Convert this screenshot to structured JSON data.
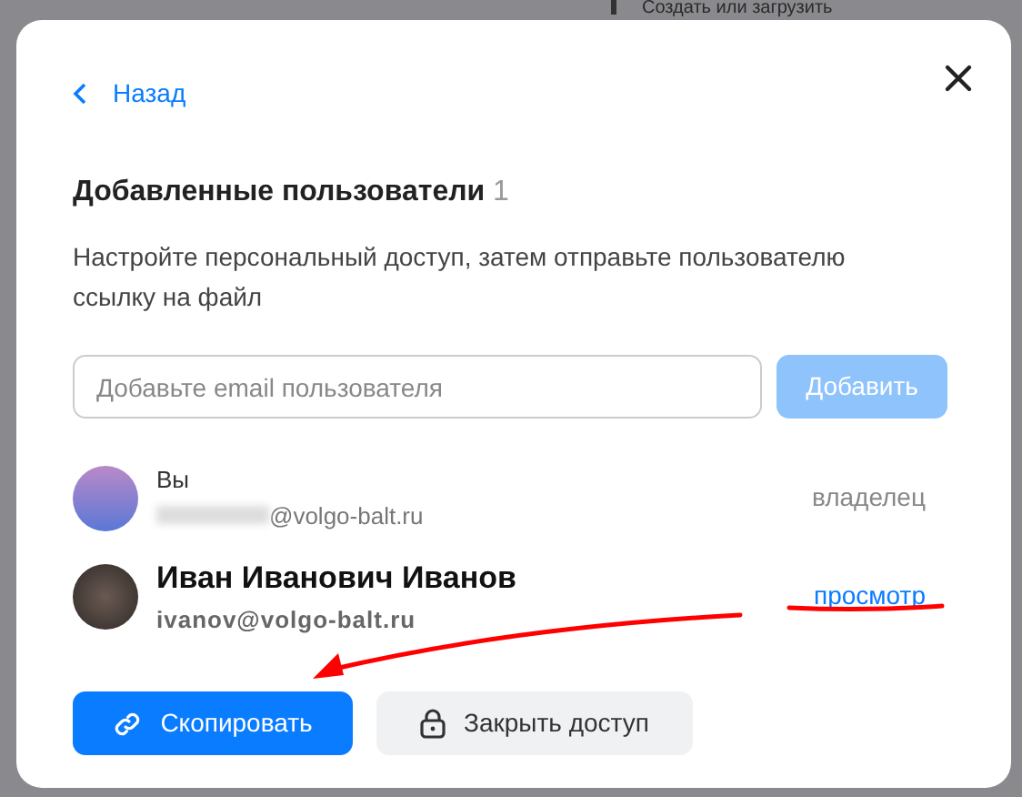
{
  "background": {
    "action": "Создать или загрузить"
  },
  "dialog": {
    "back": "Назад",
    "title": "Добавленные пользователи",
    "count": "1",
    "description": "Настройте персональный доступ, затем отправьте пользователю ссылку на файл",
    "email_field": {
      "placeholder": "Добавьте email пользователя"
    },
    "add_button": {
      "label": "Добавить",
      "disabled": true
    },
    "users": [
      {
        "kind": "self",
        "name": "Вы",
        "email": "@volgo-balt.ru",
        "email_masked": true,
        "role": "владелец"
      },
      {
        "kind": "member",
        "name": "Иван Иванович Иванов",
        "email": "ivanov@volgo-balt.ru",
        "email_masked": false,
        "role": "просмотр"
      }
    ],
    "copy_button": "Скопировать",
    "revoke_button": "Закрыть доступ"
  }
}
